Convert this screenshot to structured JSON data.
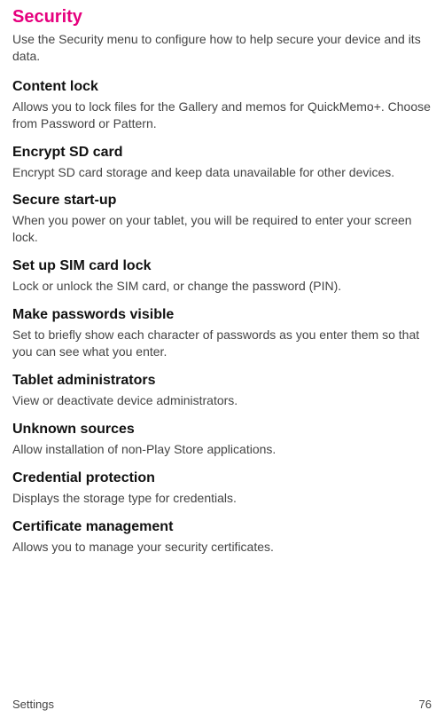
{
  "title": "Security",
  "description": "Use the Security menu to configure how to help secure your device and its data.",
  "sections": [
    {
      "heading": "Content lock",
      "body": "Allows you to lock files for the Gallery and memos for QuickMemo+. Choose from Password or Pattern."
    },
    {
      "heading": "Encrypt SD card",
      "body": "Encrypt SD card storage and keep data unavailable for other devices."
    },
    {
      "heading": "Secure start-up",
      "body": "When you power on your tablet, you will be required to enter your screen lock."
    },
    {
      "heading": "Set up SIM card lock",
      "body": "Lock or unlock the SIM card, or change the password (PIN)."
    },
    {
      "heading": "Make passwords visible",
      "body": "Set to briefly show each character of passwords as you enter them so that you can see what you enter."
    },
    {
      "heading": "Tablet administrators",
      "body": "View or deactivate device administrators."
    },
    {
      "heading": "Unknown sources",
      "body": "Allow installation of non-Play Store applications."
    },
    {
      "heading": "Credential protection",
      "body": "Displays the storage type for credentials."
    },
    {
      "heading": "Certificate management",
      "body": "Allows you to manage your security certificates."
    }
  ],
  "footer": {
    "left": "Settings",
    "right": "76"
  }
}
